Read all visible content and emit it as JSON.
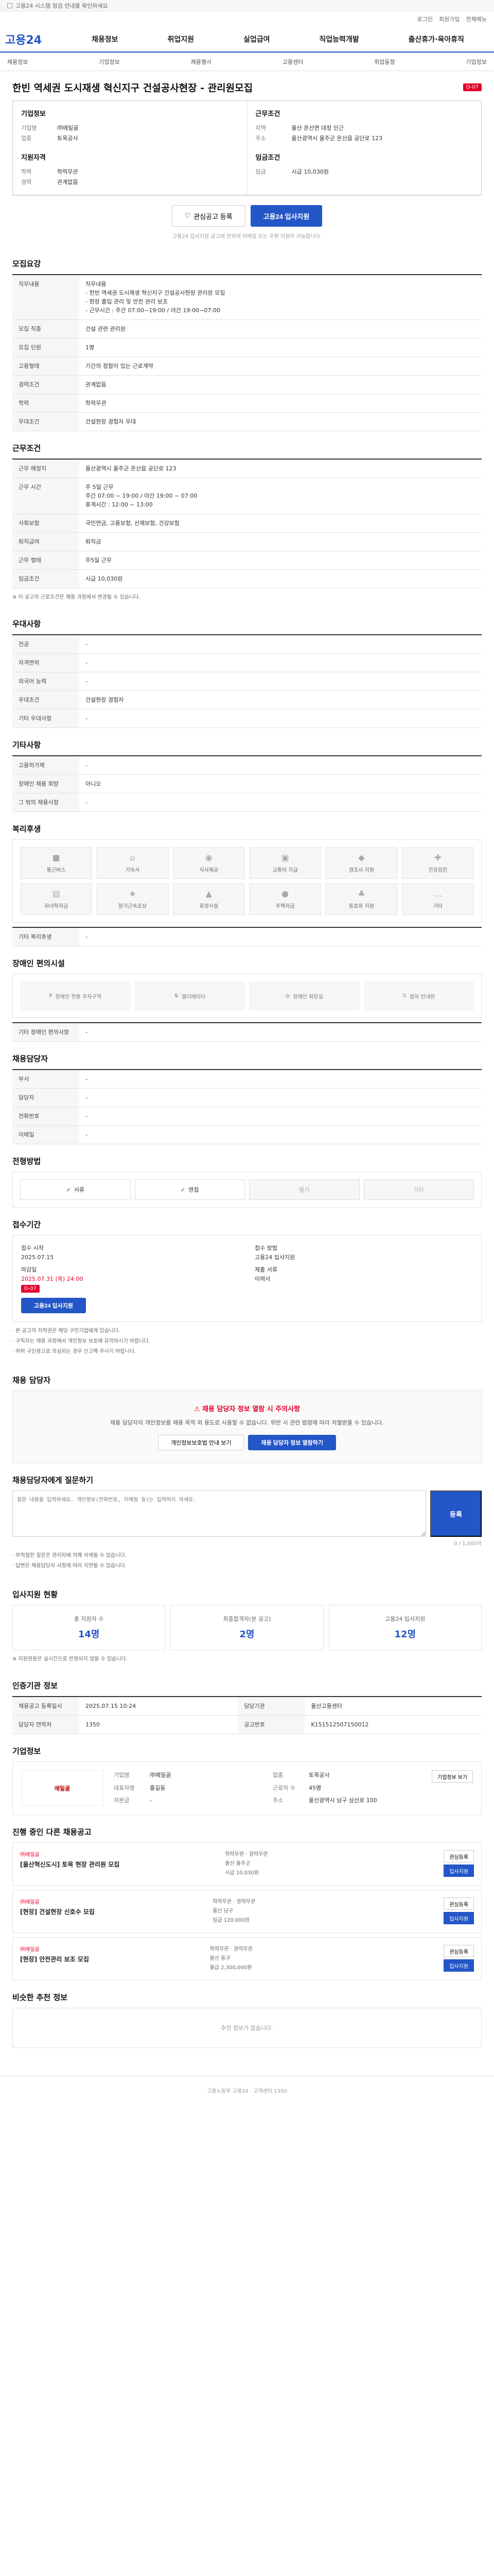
{
  "notice": "고용24 시스템 점검 안내를 확인하세요",
  "top_links": [
    "로그인",
    "회원가입",
    "전체메뉴"
  ],
  "logo": "고용24",
  "gnb": [
    "채용정보",
    "취업지원",
    "실업급여",
    "직업능력개발",
    "출산휴가·육아휴직"
  ],
  "sub_gnb": [
    "채용정보",
    "기업정보",
    "채용행사",
    "고용센터",
    "취업동향",
    "기업정보"
  ],
  "job": {
    "title": "한빈 역세권 도시재생 혁신지구 건설공사현장 - 관리원모집",
    "dday": "D-07",
    "company_heading": "기업정보",
    "company": [
      {
        "k": "기업명",
        "v": "㈜에밀골"
      },
      {
        "k": "업종",
        "v": "토목공사"
      }
    ],
    "work_heading": "근무조건",
    "work": [
      {
        "k": "지역",
        "v": "울산 온산면 대정 인근"
      },
      {
        "k": "주소",
        "v": "울산광역시 울주군 온산읍 공단로 123"
      }
    ],
    "req_heading": "지원자격",
    "req": [
      {
        "k": "학력",
        "v": "학력무관"
      },
      {
        "k": "경력",
        "v": "관계없음"
      }
    ],
    "pay_heading": "임금조건",
    "pay": [
      {
        "k": "임금",
        "v": "시급 10,030원"
      }
    ],
    "btn_scrap": "관심공고 등록",
    "btn_apply": "고용24 입사지원",
    "btn_note": "고용24 입사지원 공고에 한하여 이메일 또는 우편 지원이 가능합니다."
  },
  "recruit": {
    "heading": "모집요강",
    "duty_label": "직무내용",
    "duty_text": "직무내용\n- 한빈 역세권 도시재생 혁신지구 건설공사현장 관리원 모집\n- 현장 출입 관리 및 안전 관리 보조\n- 근무시간 : 주간 07:00~19:00 / 야간 19:00~07:00",
    "rows": [
      {
        "k": "모집 직종",
        "v": "건설 관련 관리원"
      },
      {
        "k": "모집 인원",
        "v": "1명"
      },
      {
        "k": "고용형태",
        "v": "기간의 정함이 있는 근로계약"
      },
      {
        "k": "경력조건",
        "v": "관계없음"
      },
      {
        "k": "학력",
        "v": "학력무관"
      },
      {
        "k": "우대조건",
        "v": "건설현장 경험자 우대"
      }
    ]
  },
  "condition": {
    "heading": "근무조건",
    "rows": [
      {
        "k": "근무 예정지",
        "v": "울산광역시 울주군 온산읍 공단로 123"
      },
      {
        "k": "근무 시간",
        "v": "주 5일 근무\n주간 07:00 ~ 19:00 / 야간 19:00 ~ 07:00\n휴게시간 : 12:00 ~ 13:00"
      },
      {
        "k": "사회보험",
        "v": "국민연금, 고용보험, 산재보험, 건강보험"
      },
      {
        "k": "퇴직급여",
        "v": "퇴직금"
      },
      {
        "k": "근무 형태",
        "v": "주5일 근무"
      },
      {
        "k": "임금조건",
        "v": "시급 10,030원"
      }
    ],
    "note": "※ 이 공고의 근로조건은 채용 과정에서 변경될 수 있습니다."
  },
  "apply_info": {
    "heading": "우대사항",
    "rows": [
      {
        "k": "전공",
        "v": "-"
      },
      {
        "k": "자격면허",
        "v": "-"
      },
      {
        "k": "외국어 능력",
        "v": "-"
      },
      {
        "k": "우대조건",
        "v": "건설현장 경험자"
      },
      {
        "k": "기타 우대사항",
        "v": "-"
      }
    ]
  },
  "extra": {
    "heading": "기타사항",
    "rows": [
      {
        "k": "고용허가제",
        "v": "-"
      },
      {
        "k": "장애인 채용 희망",
        "v": "아니오"
      }
    ],
    "more": "그 밖의 채용사항",
    "more_v": "-"
  },
  "welfare": {
    "heading": "복리후생",
    "items": [
      "통근버스",
      "기숙사",
      "식사제공",
      "교통비 지급",
      "경조사 지원",
      "건강검진",
      "자녀학자금",
      "장기근속포상",
      "휴양시설",
      "주택자금",
      "동호회 지원",
      "기타"
    ],
    "etc_label": "기타 복리후생",
    "etc_v": "-"
  },
  "disabled": {
    "heading": "장애인 편의시설",
    "items": [
      "장애인 전용 주차구역",
      "엘리베이터",
      "장애인 화장실",
      "점자 안내판"
    ],
    "etc_label": "기타 장애인 편의사항",
    "etc_v": "-"
  },
  "contact": {
    "heading": "채용담당자",
    "rows": [
      {
        "k": "부서",
        "v": "-"
      },
      {
        "k": "담당자",
        "v": "-"
      },
      {
        "k": "전화번호",
        "v": "-"
      },
      {
        "k": "이메일",
        "v": "-"
      }
    ]
  },
  "method": {
    "heading": "전형방법",
    "items": [
      {
        "label": "서류",
        "on": true
      },
      {
        "label": "면접",
        "on": true
      },
      {
        "label": "필기",
        "on": false
      },
      {
        "label": "기타",
        "on": false
      }
    ]
  },
  "period": {
    "heading": "접수기간",
    "start_label": "접수 시작",
    "start": "2025.07.15",
    "deadline_label": "마감일",
    "deadline": "2025.07.31 (목) 24:00",
    "dday": "D-07",
    "how_label": "접수 방법",
    "how": "고용24 입사지원",
    "docs_label": "제출 서류",
    "docs": "이력서",
    "apply_btn": "고용24 입사지원",
    "warn": [
      "· 본 공고의 저작권은 해당 구인기업에게 있습니다.",
      "· 구직자는 채용 과정에서 개인정보 보호에 유의하시기 바랍니다.",
      "· 허위 구인광고로 의심되는 경우 신고해 주시기 바랍니다."
    ]
  },
  "report": {
    "heading": "채용 담당자",
    "title": "채용 담당자 정보 열람 시 주의사항",
    "text": "채용 담당자의 개인정보를 채용 목적 외 용도로 사용할 수 없습니다. 위반 시 관련 법령에 따라 처벌받을 수 있습니다.",
    "btn1": "개인정보보호법 안내 보기",
    "btn2": "채용 담당자 정보 열람하기"
  },
  "qa": {
    "heading": "채용담당자에게 질문하기",
    "placeholder": "질문 내용을 입력하세요. 개인정보(전화번호, 이메일 등)는 입력하지 마세요.",
    "count": "0 / 1,000자",
    "btn": "등록",
    "notes": [
      "· 부적절한 질문은 관리자에 의해 삭제될 수 있습니다.",
      "· 답변은 채용담당자 사정에 따라 지연될 수 있습니다."
    ]
  },
  "stats": {
    "heading": "입사지원 현황",
    "items": [
      {
        "t": "총 지원자 수",
        "n": "14명"
      },
      {
        "t": "최종합격자(본 공고)",
        "n": "2명"
      },
      {
        "t": "고용24 입사지원",
        "n": "12명"
      }
    ],
    "note": "※ 지원현황은 실시간으로 반영되지 않을 수 있습니다."
  },
  "regist": {
    "heading": "인증기관 정보",
    "rows": [
      {
        "k": "채용공고 등록일시",
        "v": "2025.07.15 10:24"
      },
      {
        "k": "담당기관",
        "v": "울산고용센터"
      },
      {
        "k": "담당자 연락처",
        "v": "1350"
      },
      {
        "k": "공고번호",
        "v": "K151512507150012"
      }
    ]
  },
  "company_info": {
    "heading": "기업정보",
    "logo_text": "에밀골",
    "rows": [
      {
        "k": "기업명",
        "v": "㈜에밀골"
      },
      {
        "k": "업종",
        "v": "토목공사"
      },
      {
        "k": "대표자명",
        "v": "홍길동"
      },
      {
        "k": "근로자 수",
        "v": "45명"
      },
      {
        "k": "자본금",
        "v": "-"
      },
      {
        "k": "주소",
        "v": "울산광역시 남구 삼산로 100"
      }
    ],
    "btn": "기업정보 보기"
  },
  "other_jobs": {
    "heading": "진행 중인 다른 채용공고",
    "items": [
      {
        "co": "㈜에밀골",
        "title": "[울산혁신도시] 토목 현장 관리원 모집",
        "meta": [
          "학력무관 · 경력무관",
          "울산 울주군",
          "시급 10,030원"
        ]
      },
      {
        "co": "㈜에밀골",
        "title": "[현장] 건설현장 신호수 모집",
        "meta": [
          "학력무관 · 경력무관",
          "울산 남구",
          "일급 120,000원"
        ]
      },
      {
        "co": "㈜에밀골",
        "title": "[현장] 안전관리 보조 모집",
        "meta": [
          "학력무관 · 경력무관",
          "울산 동구",
          "월급 2,300,000원"
        ]
      }
    ],
    "btn_scrap": "관심등록",
    "btn_apply": "입사지원"
  },
  "recommend": {
    "heading": "비슷한 추천 정보",
    "empty": "추천 정보가 없습니다."
  },
  "footer": "고용노동부 고용24 · 고객센터 1350"
}
